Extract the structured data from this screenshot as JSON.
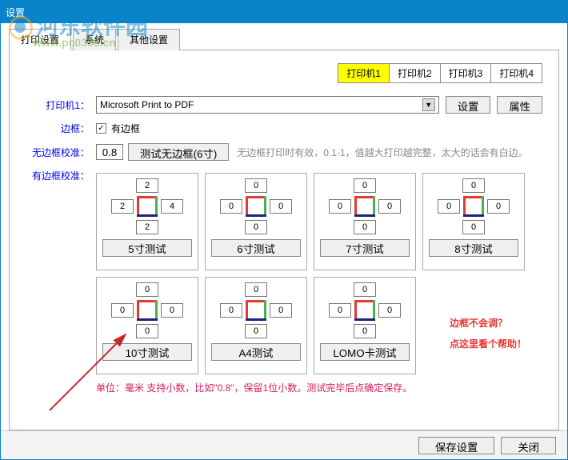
{
  "window": {
    "title": "设置"
  },
  "watermark": {
    "text": "河东软件园",
    "url": "www.pc0359.cn"
  },
  "tabs": {
    "items": [
      "打印设置",
      "系统",
      "其他设置"
    ],
    "active": 0
  },
  "printer_tabs": {
    "items": [
      "打印机1",
      "打印机2",
      "打印机3",
      "打印机4"
    ],
    "active": 0
  },
  "printer": {
    "label": "打印机1：",
    "value": "Microsoft Print to PDF",
    "settings_btn": "设置",
    "props_btn": "属性"
  },
  "border": {
    "label": "边框：",
    "checked": true,
    "text": "有边框"
  },
  "noborder": {
    "label": "无边框校准：",
    "value": "0.8",
    "test_btn": "测试无边框(6寸)",
    "hint": "无边框打印时有效，0.1-1，值越大打印越完整，太大的话会有白边。"
  },
  "hasborder": {
    "label": "有边框校准："
  },
  "calib": [
    {
      "top": "2",
      "left": "2",
      "right": "4",
      "bottom": "2",
      "btn": "5寸测试"
    },
    {
      "top": "0",
      "left": "0",
      "right": "0",
      "bottom": "0",
      "btn": "6寸测试"
    },
    {
      "top": "0",
      "left": "0",
      "right": "0",
      "bottom": "0",
      "btn": "7寸测试"
    },
    {
      "top": "0",
      "left": "0",
      "right": "0",
      "bottom": "0",
      "btn": "8寸测试"
    },
    {
      "top": "0",
      "left": "0",
      "right": "0",
      "bottom": "0",
      "btn": "10寸测试"
    },
    {
      "top": "0",
      "left": "0",
      "right": "0",
      "bottom": "0",
      "btn": "A4测试"
    },
    {
      "top": "0",
      "left": "0",
      "right": "0",
      "bottom": "0",
      "btn": "LOMO卡测试"
    }
  ],
  "help": {
    "line1": "边框不会调？",
    "line2": "点这里看个帮助！"
  },
  "footer_hint": "单位：毫米  支持小数，比如\"0.8\"，保留1位小数。测试完毕后点确定保存。",
  "buttons": {
    "save": "保存设置",
    "close": "关闭"
  }
}
